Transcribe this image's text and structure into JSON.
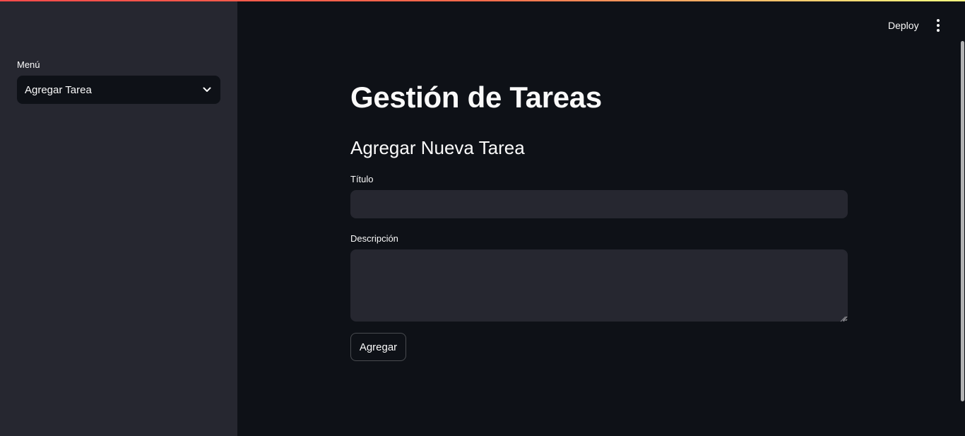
{
  "header": {
    "deploy_label": "Deploy",
    "menu_icon": "kebab-vertical-icon"
  },
  "sidebar": {
    "menu_label": "Menú",
    "menu_selected": "Agregar Tarea",
    "menu_icon": "chevron-down-icon"
  },
  "main": {
    "title": "Gestión de Tareas",
    "section_title": "Agregar Nueva Tarea",
    "title_field": {
      "label": "Título",
      "value": ""
    },
    "description_field": {
      "label": "Descripción",
      "value": ""
    },
    "submit_label": "Agregar"
  },
  "theme": {
    "background": "#0e1117",
    "sidebar_background": "#262730",
    "input_background": "#262730",
    "text": "#fafafa",
    "accent": "#ff4b4b"
  }
}
